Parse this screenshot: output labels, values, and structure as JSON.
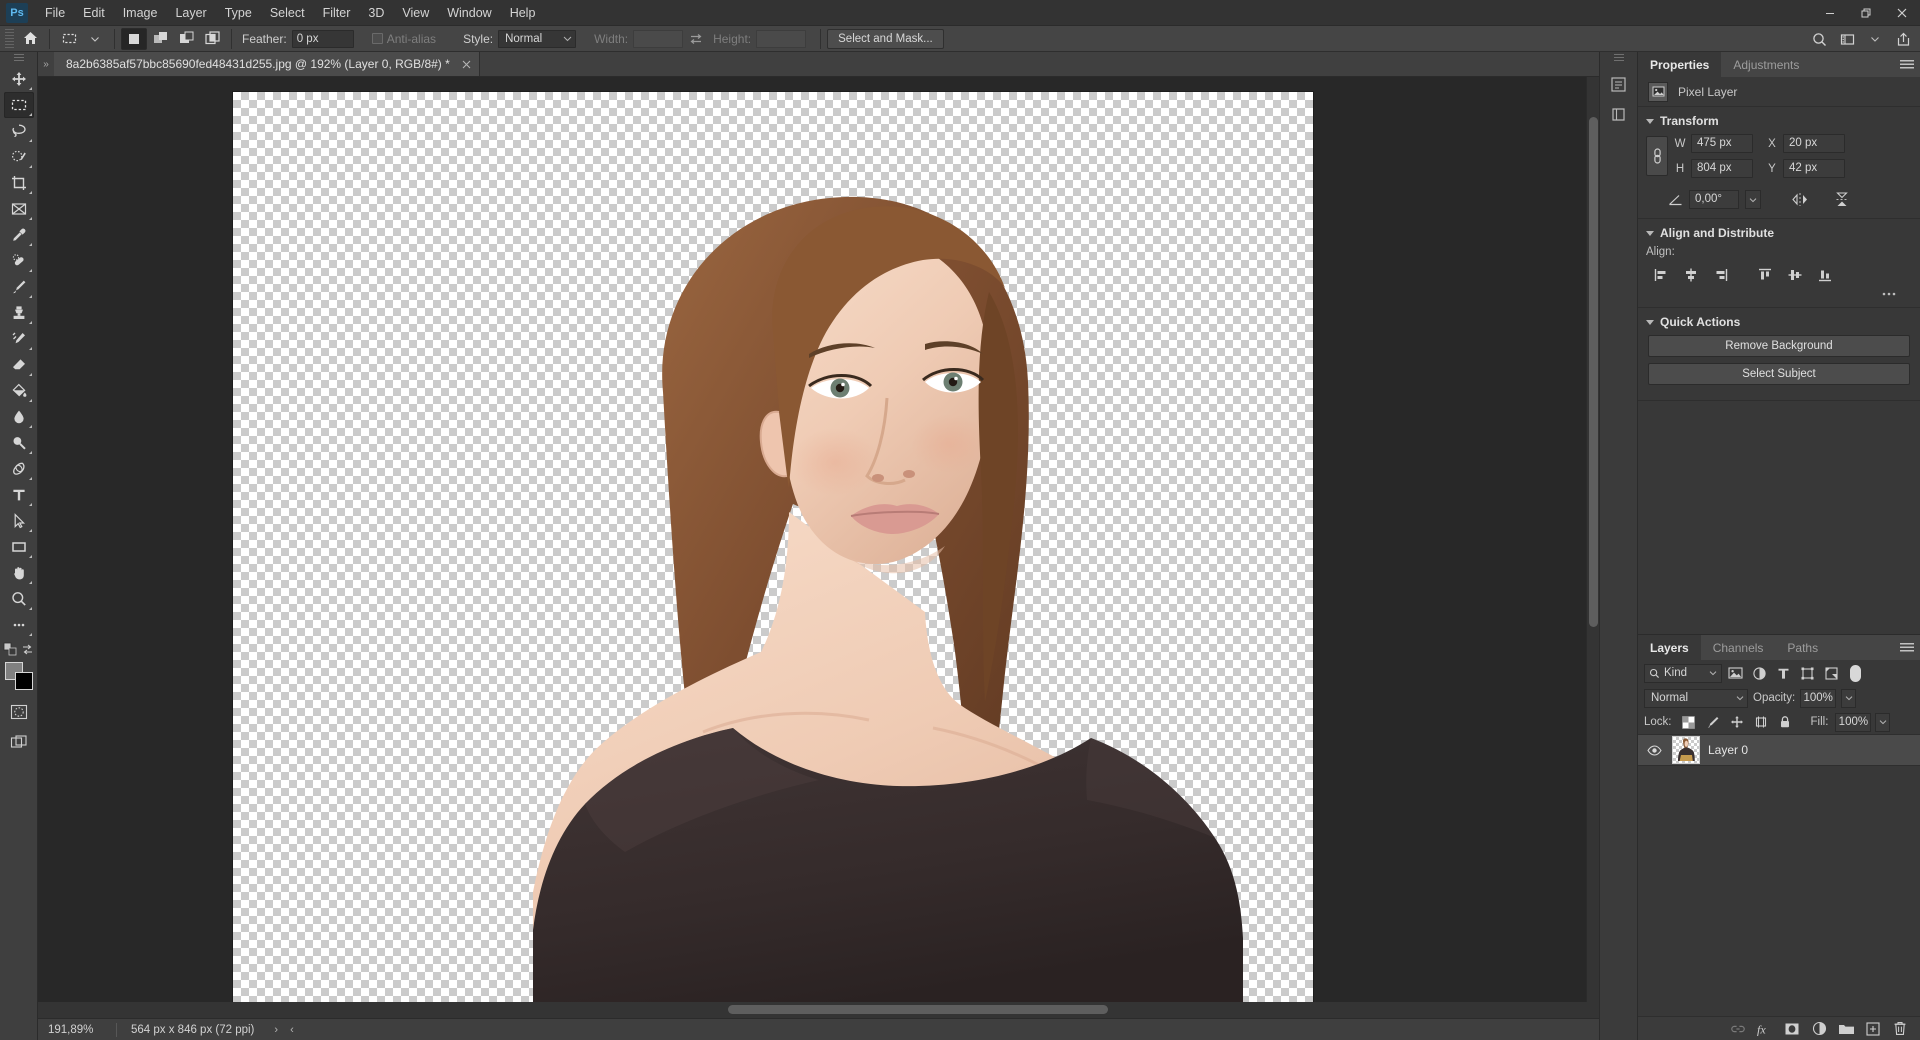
{
  "app": {
    "name": "Adobe Photoshop",
    "logo_text": "Ps",
    "accent": "#5fb9ef"
  },
  "menubar": {
    "items": [
      "File",
      "Edit",
      "Image",
      "Layer",
      "Type",
      "Select",
      "Filter",
      "3D",
      "View",
      "Window",
      "Help"
    ],
    "window_controls": [
      "minimize-button",
      "restore-button",
      "close-button"
    ]
  },
  "options_bar": {
    "home_icon": "home-icon",
    "tool_preset_icon": "rectangular-marquee-icon",
    "selection_modes": [
      "new-selection-icon",
      "add-to-selection-icon",
      "subtract-from-selection-icon",
      "intersect-with-selection-icon"
    ],
    "feather_label": "Feather:",
    "feather_value": "0 px",
    "antialias_label": "Anti-alias",
    "antialias_checked": false,
    "style_label": "Style:",
    "style_value": "Normal",
    "width_label": "Width:",
    "width_value": "",
    "swap_icon": "swap-dimensions-icon",
    "height_label": "Height:",
    "height_value": "",
    "select_and_mask_label": "Select and Mask...",
    "right_icons": [
      "search-icon",
      "workspace-icon",
      "chevron-down-icon",
      "share-icon"
    ]
  },
  "toolbar": {
    "tools": [
      {
        "name": "move-tool",
        "selected": false
      },
      {
        "name": "rectangular-marquee-tool",
        "selected": true
      },
      {
        "name": "lasso-tool",
        "selected": false
      },
      {
        "name": "quick-selection-tool",
        "selected": false
      },
      {
        "name": "crop-tool",
        "selected": false
      },
      {
        "name": "frame-tool",
        "selected": false
      },
      {
        "name": "eyedropper-tool",
        "selected": false
      },
      {
        "name": "spot-healing-brush-tool",
        "selected": false
      },
      {
        "name": "brush-tool",
        "selected": false
      },
      {
        "name": "clone-stamp-tool",
        "selected": false
      },
      {
        "name": "history-brush-tool",
        "selected": false
      },
      {
        "name": "eraser-tool",
        "selected": false
      },
      {
        "name": "gradient-tool",
        "selected": false
      },
      {
        "name": "blur-tool",
        "selected": false
      },
      {
        "name": "dodge-tool",
        "selected": false
      },
      {
        "name": "pen-tool",
        "selected": false
      },
      {
        "name": "type-tool",
        "selected": false
      },
      {
        "name": "path-selection-tool",
        "selected": false
      },
      {
        "name": "rectangle-tool",
        "selected": false
      },
      {
        "name": "hand-tool",
        "selected": false
      },
      {
        "name": "zoom-tool",
        "selected": false
      },
      {
        "name": "edit-toolbar-tool",
        "selected": false
      }
    ],
    "foreground_color": "#808080",
    "background_color": "#000000",
    "quick-mask-icon": "quick-mask-mode",
    "screen-mode-icon": "screen-mode"
  },
  "document": {
    "tab_title": "8a2b6385af57bbc85690fed48431d255.jpg @ 192% (Layer 0, RGB/8#) *",
    "close_icon": "close-tab-icon"
  },
  "status_bar": {
    "zoom": "191,89%",
    "doc_size": "564 px x 846 px (72 ppi)",
    "next_icon": "chevron-right-icon",
    "prev_icon": "chevron-left-icon"
  },
  "right_dock": {
    "icons": [
      "properties-dock-icon",
      "libraries-dock-icon"
    ]
  },
  "properties_panel": {
    "tabs": [
      {
        "label": "Properties",
        "active": true
      },
      {
        "label": "Adjustments",
        "active": false
      }
    ],
    "menu_icon": "panel-menu-icon",
    "layer_type": "Pixel Layer",
    "layer_type_icon": "pixel-layer-icon",
    "transform": {
      "title": "Transform",
      "link_icon": "link-dimensions-icon",
      "w_label": "W",
      "w_value": "475 px",
      "h_label": "H",
      "h_value": "804 px",
      "x_label": "X",
      "x_value": "20 px",
      "y_label": "Y",
      "y_value": "42 px",
      "angle_icon": "angle-icon",
      "angle_value": "0,00°",
      "flip_horizontal_icon": "flip-horizontal-icon",
      "flip_vertical_icon": "flip-vertical-icon"
    },
    "align": {
      "title": "Align and Distribute",
      "label": "Align:",
      "buttons": [
        "align-left-edges-icon",
        "align-horizontal-centers-icon",
        "align-right-edges-icon",
        "align-top-edges-icon",
        "align-vertical-centers-icon",
        "align-bottom-edges-icon"
      ],
      "more_icon": "more-options-icon"
    },
    "quick_actions": {
      "title": "Quick Actions",
      "buttons": [
        "Remove Background",
        "Select Subject"
      ]
    }
  },
  "layers_panel": {
    "tabs": [
      {
        "label": "Layers",
        "active": true
      },
      {
        "label": "Channels",
        "active": false
      },
      {
        "label": "Paths",
        "active": false
      }
    ],
    "menu_icon": "panel-menu-icon",
    "filter": {
      "search_icon": "search-icon",
      "kind_label": "Kind",
      "chevron_icon": "chevron-down-icon",
      "type_filters": [
        "filter-pixel-layers-icon",
        "filter-adjustment-layers-icon",
        "filter-type-layers-icon",
        "filter-shape-layers-icon",
        "filter-smart-objects-icon"
      ],
      "toggle_icon": "filter-toggle-switch"
    },
    "blend_mode": "Normal",
    "opacity_label": "Opacity:",
    "opacity_value": "100%",
    "lock_label": "Lock:",
    "lock_icons": [
      "lock-transparent-pixels-icon",
      "lock-image-pixels-icon",
      "lock-position-icon",
      "lock-artboard-nesting-icon",
      "lock-all-icon"
    ],
    "fill_label": "Fill:",
    "fill_value": "100%",
    "layers": [
      {
        "name": "Layer 0",
        "visible": true,
        "eye_icon": "eye-visible-icon",
        "selected": true
      }
    ],
    "footer_icons": [
      "link-layers-icon",
      "layer-style-fx-icon",
      "add-layer-mask-icon",
      "new-adjustment-layer-icon",
      "new-group-icon",
      "new-layer-icon",
      "delete-layer-icon"
    ]
  },
  "canvas": {
    "checkerboard": true,
    "subject_alt": "portrait-of-woman-with-transparent-background",
    "colors": {
      "hair": "#8a5a3a",
      "skin": "#f0cdb6",
      "top": "#3a3030",
      "checker_light": "#ffffff",
      "checker_dark": "#cbcbcb"
    }
  }
}
